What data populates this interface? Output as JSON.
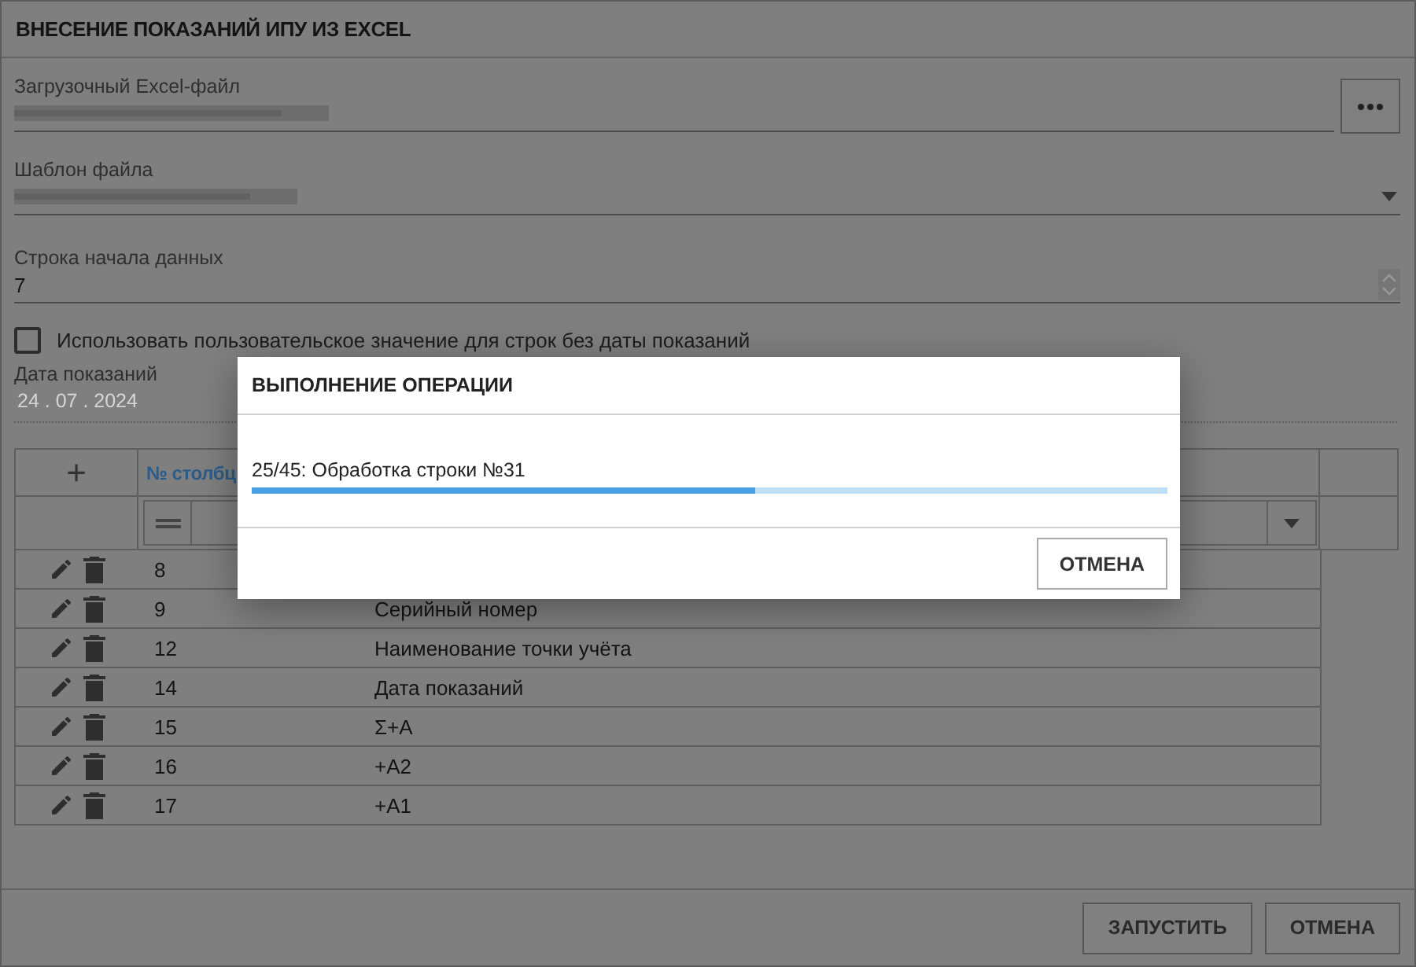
{
  "window": {
    "title": "ВНЕСЕНИЕ ПОКАЗАНИЙ ИПУ ИЗ EXCEL"
  },
  "fields": [
    {
      "kind": "file",
      "label": "Загрузочный Excel-файл",
      "blurred": true
    },
    {
      "kind": "select",
      "label": "Шаблон файла",
      "blurred": true
    },
    {
      "kind": "number",
      "label": "Строка начала данных",
      "value": "7"
    }
  ],
  "custom_date": {
    "label": "Использовать пользовательское значение для строк без даты показаний",
    "checked": false,
    "date_label": "Дата показаний",
    "date_value": "24 . 07 . 2024",
    "disabled": true
  },
  "table": {
    "add": "+",
    "columns": [
      "№ столбц"
    ],
    "rows": [
      {
        "number": "8"
      },
      {
        "number": "9",
        "name": "Серийный номер"
      },
      {
        "number": "12",
        "name": "Наименование точки учёта"
      },
      {
        "number": "14",
        "name": "Дата показаний"
      },
      {
        "number": "15",
        "name": "Σ+A"
      },
      {
        "number": "16",
        "name": "+A2"
      },
      {
        "number": "17",
        "name": "+A1"
      }
    ]
  },
  "buttons": [
    "ЗАПУСТИТЬ",
    "ОТМЕНА"
  ],
  "dialog": {
    "title": "ВЫПОЛНЕНИЕ ОПЕРАЦИИ",
    "message": "25/45: Обработка строки №31",
    "level": 0.55,
    "buttons": [
      "ОТМЕНА"
    ]
  }
}
